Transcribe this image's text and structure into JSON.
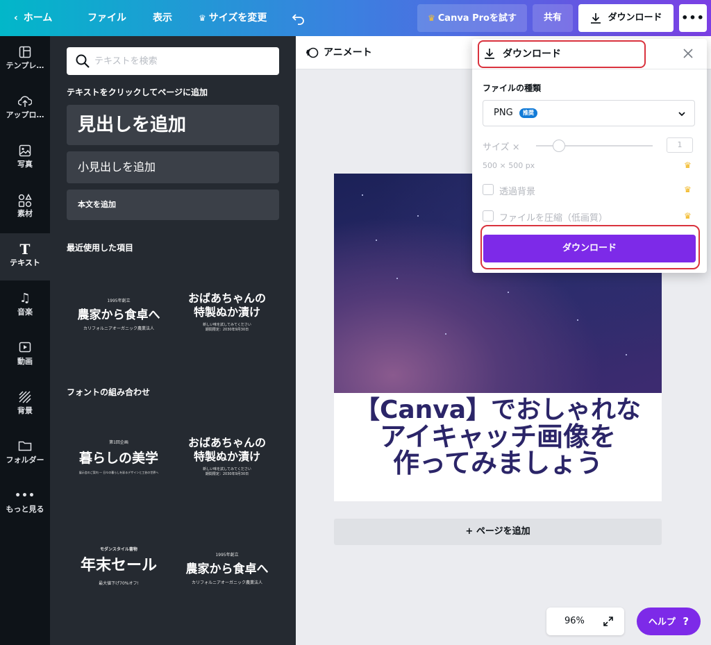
{
  "colors": {
    "accent": "#7d2ae8",
    "highlight": "#d9323d",
    "crown": "#f8c22b"
  },
  "topbar": {
    "home": "ホーム",
    "file": "ファイル",
    "view": "表示",
    "resize": "サイズを変更",
    "try_pro": "Canva Proを試す",
    "share": "共有",
    "download": "ダウンロード",
    "more_icon": "more-icon"
  },
  "rail": {
    "items": [
      {
        "label": "テンプレ…",
        "icon": "template-icon"
      },
      {
        "label": "アップロ…",
        "icon": "upload-icon"
      },
      {
        "label": "写真",
        "icon": "photo-icon"
      },
      {
        "label": "素材",
        "icon": "elements-icon"
      },
      {
        "label": "テキスト",
        "icon": "text-icon"
      },
      {
        "label": "音楽",
        "icon": "music-icon"
      },
      {
        "label": "動画",
        "icon": "video-icon"
      },
      {
        "label": "背景",
        "icon": "background-icon"
      },
      {
        "label": "フォルダー",
        "icon": "folder-icon"
      },
      {
        "label": "もっと見る",
        "icon": "more-icon"
      }
    ]
  },
  "panel": {
    "search_placeholder": "テキストを検索",
    "click_to_add": "テキストをクリックしてページに追加",
    "add_heading": "見出しを追加",
    "add_subheading": "小見出しを追加",
    "add_body": "本文を追加",
    "recent_title": "最近使用した項目",
    "combo_title": "フォントの組み合わせ",
    "tiles": {
      "t1_small": "1995年創立",
      "t1_big": "農家から食卓へ",
      "t1_sub": "カリフォルニアオーガニック農業法人",
      "t2_line1": "おばあちゃんの",
      "t2_line2": "特製ぬか漬け",
      "t2_sub1": "新しい味を試してみてください",
      "t2_sub2": "期間限定：2030年9月30日",
      "t3_small": "第1回企画",
      "t3_big": "暮らしの美学",
      "t3_sub": "展示会のご案内 — 日々の暮らしを彩るデザインと工芸の世界へ",
      "t5_small": "モダンスタイル書物",
      "t5_big": "年末セール",
      "t5_sub": "最大値下げ70%オフ!"
    }
  },
  "canvas": {
    "animate": "アニメート",
    "headline_1": "【Canva】でおしゃれな",
    "headline_2": "アイキャッチ画像を",
    "headline_3": "作ってみましょう",
    "add_page": "+ ページを追加",
    "zoom": "96%",
    "help": "ヘルプ",
    "help_mark": "?"
  },
  "download_panel": {
    "title": "ダウンロード",
    "file_type_label": "ファイルの種類",
    "file_type_value": "PNG",
    "recommended_badge": "推奨",
    "size_label": "サイズ ×",
    "size_value": "1",
    "dimensions": "500 × 500 px",
    "transparent_bg": "透過背景",
    "compress": "ファイルを圧縮（低画質）",
    "download_button": "ダウンロード"
  }
}
